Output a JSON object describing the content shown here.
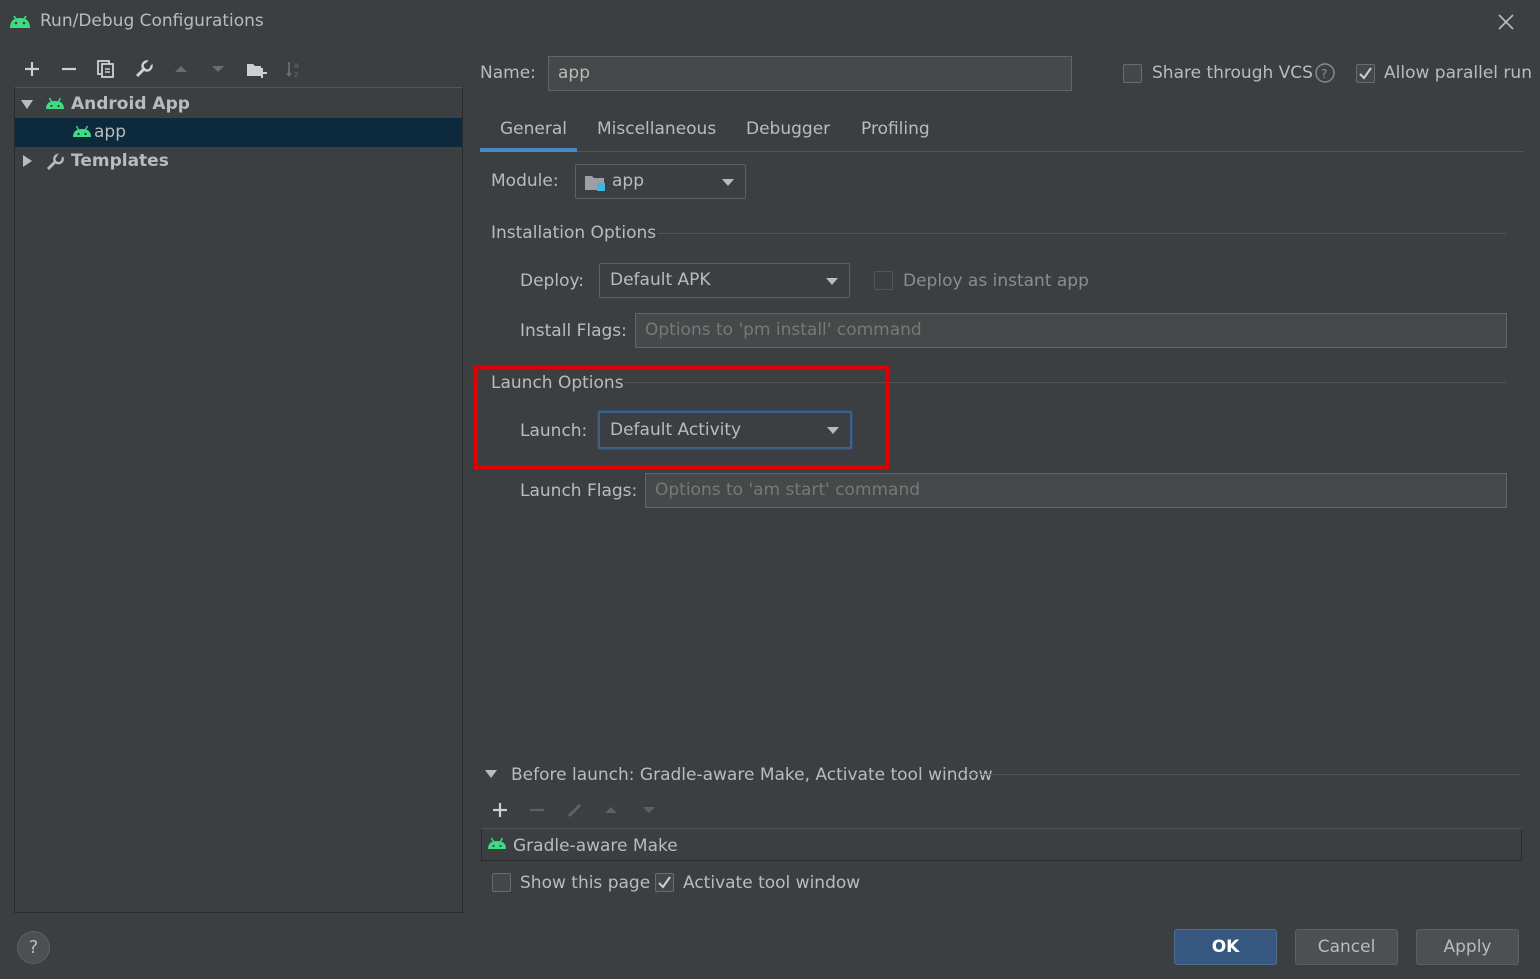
{
  "window": {
    "title": "Run/Debug Configurations"
  },
  "left_toolbar": {
    "buttons": [
      "add-icon",
      "remove-icon",
      "copy-icon",
      "wrench-icon",
      "move-up-icon",
      "move-down-icon",
      "new-folder-icon",
      "sort-icon"
    ]
  },
  "tree": {
    "items": [
      {
        "label": "Android App",
        "expanded": true,
        "bold": true,
        "icon": "android-icon"
      },
      {
        "label": "app",
        "selected": true,
        "icon": "android-icon"
      },
      {
        "label": "Templates",
        "expanded": false,
        "bold": true,
        "icon": "wrench-icon"
      }
    ]
  },
  "header": {
    "name_label": "Name:",
    "name_value": "app",
    "share_vcs_label": "Share through VCS",
    "share_vcs_checked": false,
    "allow_parallel_label": "Allow parallel run",
    "allow_parallel_checked": true
  },
  "tabs": [
    {
      "label": "General",
      "active": true
    },
    {
      "label": "Miscellaneous",
      "active": false
    },
    {
      "label": "Debugger",
      "active": false
    },
    {
      "label": "Profiling",
      "active": false
    }
  ],
  "general": {
    "module_label": "Module:",
    "module_value": "app",
    "installation_options_title": "Installation Options",
    "deploy_label": "Deploy:",
    "deploy_value": "Default APK",
    "deploy_instant_label": "Deploy as instant app",
    "install_flags_label": "Install Flags:",
    "install_flags_placeholder": "Options to 'pm install' command",
    "launch_options_title": "Launch Options",
    "launch_label": "Launch:",
    "launch_value": "Default Activity",
    "launch_flags_label": "Launch Flags:",
    "launch_flags_placeholder": "Options to 'am start' command"
  },
  "before_launch": {
    "title": "Before launch: Gradle-aware Make, Activate tool window",
    "tasks": [
      "Gradle-aware Make"
    ],
    "show_page_label": "Show this page",
    "show_page_checked": false,
    "activate_tool_label": "Activate tool window",
    "activate_tool_checked": true
  },
  "footer": {
    "ok_label": "OK",
    "cancel_label": "Cancel",
    "apply_label": "Apply"
  },
  "colors": {
    "background": "#3c3f41",
    "selection": "#0d293e",
    "accent": "#4a88c7",
    "android_green": "#3ddc84",
    "highlight_box": "#e00000"
  }
}
